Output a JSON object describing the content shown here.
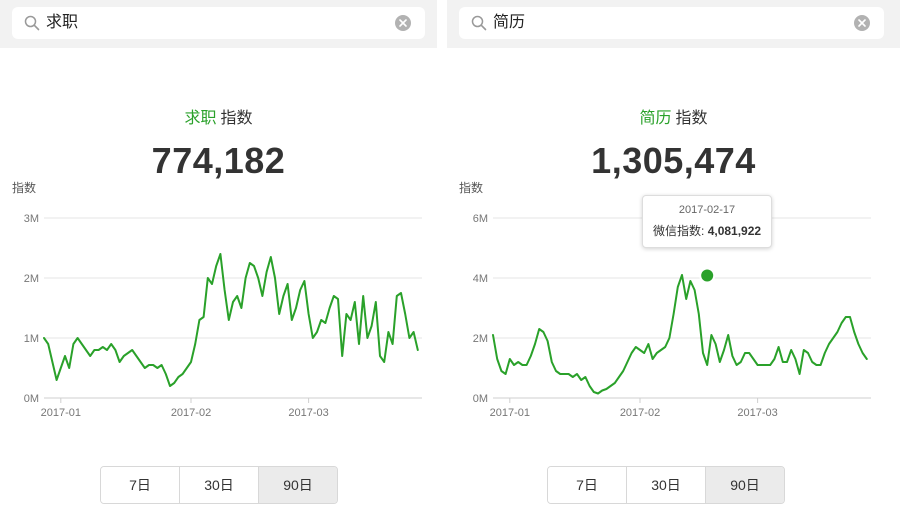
{
  "colors": {
    "accent": "#2aa12a",
    "line": "#2aa12a",
    "grid": "#e6e6e6",
    "text": "#333333"
  },
  "panels": [
    {
      "search": {
        "query": "求职"
      },
      "title": {
        "keyword": "求职",
        "suffix": "指数"
      },
      "index_value": "774,182",
      "range_tabs": [
        {
          "label": "7日"
        },
        {
          "label": "30日"
        },
        {
          "label": "90日",
          "selected": true
        }
      ],
      "chart_data": {
        "type": "line",
        "ylabel": "指数",
        "ylim": [
          0,
          3000000
        ],
        "yticks": [
          {
            "v": 0,
            "label": "0M"
          },
          {
            "v": 1000000,
            "label": "1M"
          },
          {
            "v": 2000000,
            "label": "2M"
          },
          {
            "v": 3000000,
            "label": "3M"
          }
        ],
        "xlim": [
          0,
          90
        ],
        "xticks": [
          {
            "x": 4,
            "label": "2017-01"
          },
          {
            "x": 35,
            "label": "2017-02"
          },
          {
            "x": 63,
            "label": "2017-03"
          }
        ],
        "series": [
          {
            "x": [
              0,
              1,
              2,
              3,
              4,
              5,
              6,
              7,
              8,
              9,
              10,
              11,
              12,
              13,
              14,
              15,
              16,
              17,
              18,
              19,
              20,
              21,
              22,
              23,
              24,
              25,
              26,
              27,
              28,
              29,
              30,
              31,
              32,
              33,
              34,
              35,
              36,
              37,
              38,
              39,
              40,
              41,
              42,
              43,
              44,
              45,
              46,
              47,
              48,
              49,
              50,
              51,
              52,
              53,
              54,
              55,
              56,
              57,
              58,
              59,
              60,
              61,
              62,
              63,
              64,
              65,
              66,
              67,
              68,
              69,
              70,
              71,
              72,
              73,
              74,
              75,
              76,
              77,
              78,
              79,
              80,
              81,
              82,
              83,
              84,
              85,
              86,
              87,
              88,
              89
            ],
            "y": [
              1000000,
              900000,
              600000,
              300000,
              500000,
              700000,
              500000,
              900000,
              1000000,
              900000,
              800000,
              700000,
              800000,
              800000,
              850000,
              800000,
              900000,
              800000,
              600000,
              700000,
              750000,
              800000,
              700000,
              600000,
              500000,
              550000,
              550000,
              500000,
              550000,
              400000,
              200000,
              250000,
              350000,
              400000,
              500000,
              600000,
              900000,
              1300000,
              1350000,
              2000000,
              1900000,
              2200000,
              2400000,
              1800000,
              1300000,
              1600000,
              1700000,
              1500000,
              2000000,
              2250000,
              2200000,
              2000000,
              1700000,
              2100000,
              2350000,
              2000000,
              1400000,
              1700000,
              1900000,
              1300000,
              1500000,
              1800000,
              1950000,
              1400000,
              1000000,
              1100000,
              1300000,
              1250000,
              1500000,
              1700000,
              1650000,
              700000,
              1400000,
              1300000,
              1600000,
              900000,
              1700000,
              1000000,
              1200000,
              1600000,
              700000,
              600000,
              1100000,
              900000,
              1700000,
              1750000,
              1400000,
              1000000,
              1100000,
              800000
            ]
          }
        ]
      }
    },
    {
      "search": {
        "query": "简历"
      },
      "title": {
        "keyword": "简历",
        "suffix": "指数"
      },
      "index_value": "1,305,474",
      "range_tabs": [
        {
          "label": "7日"
        },
        {
          "label": "30日"
        },
        {
          "label": "90日",
          "selected": true
        }
      ],
      "tooltip": {
        "date": "2017-02-17",
        "label": "微信指数:",
        "value": "4,081,922"
      },
      "chart_data": {
        "type": "line",
        "ylabel": "指数",
        "ylim": [
          0,
          6000000
        ],
        "yticks": [
          {
            "v": 0,
            "label": "0M"
          },
          {
            "v": 2000000,
            "label": "2M"
          },
          {
            "v": 4000000,
            "label": "4M"
          },
          {
            "v": 6000000,
            "label": "6M"
          }
        ],
        "xlim": [
          0,
          90
        ],
        "xticks": [
          {
            "x": 4,
            "label": "2017-01"
          },
          {
            "x": 35,
            "label": "2017-02"
          },
          {
            "x": 63,
            "label": "2017-03"
          }
        ],
        "highlight_index": 51,
        "series": [
          {
            "x": [
              0,
              1,
              2,
              3,
              4,
              5,
              6,
              7,
              8,
              9,
              10,
              11,
              12,
              13,
              14,
              15,
              16,
              17,
              18,
              19,
              20,
              21,
              22,
              23,
              24,
              25,
              26,
              27,
              28,
              29,
              30,
              31,
              32,
              33,
              34,
              35,
              36,
              37,
              38,
              39,
              40,
              41,
              42,
              43,
              44,
              45,
              46,
              47,
              48,
              49,
              50,
              51,
              52,
              53,
              54,
              55,
              56,
              57,
              58,
              59,
              60,
              61,
              62,
              63,
              64,
              65,
              66,
              67,
              68,
              69,
              70,
              71,
              72,
              73,
              74,
              75,
              76,
              77,
              78,
              79,
              80,
              81,
              82,
              83,
              84,
              85,
              86,
              87,
              88,
              89
            ],
            "y": [
              2100000,
              1300000,
              900000,
              800000,
              1300000,
              1100000,
              1200000,
              1100000,
              1100000,
              1400000,
              1800000,
              2300000,
              2200000,
              1900000,
              1200000,
              900000,
              800000,
              800000,
              800000,
              700000,
              800000,
              600000,
              700000,
              400000,
              200000,
              150000,
              250000,
              300000,
              400000,
              500000,
              700000,
              900000,
              1200000,
              1500000,
              1700000,
              1600000,
              1500000,
              1800000,
              1300000,
              1500000,
              1600000,
              1700000,
              2000000,
              2800000,
              3700000,
              4100000,
              3300000,
              3900000,
              3600000,
              2800000,
              1500000,
              1100000,
              2100000,
              1800000,
              1200000,
              1600000,
              2100000,
              1400000,
              1100000,
              1200000,
              1500000,
              1500000,
              1300000,
              1100000,
              1100000,
              1100000,
              1100000,
              1300000,
              1700000,
              1200000,
              1200000,
              1600000,
              1300000,
              800000,
              1600000,
              1500000,
              1200000,
              1100000,
              1100000,
              1500000,
              1800000,
              2000000,
              2200000,
              2500000,
              2700000,
              2700000,
              2200000,
              1800000,
              1500000,
              1300000
            ]
          }
        ]
      }
    }
  ]
}
